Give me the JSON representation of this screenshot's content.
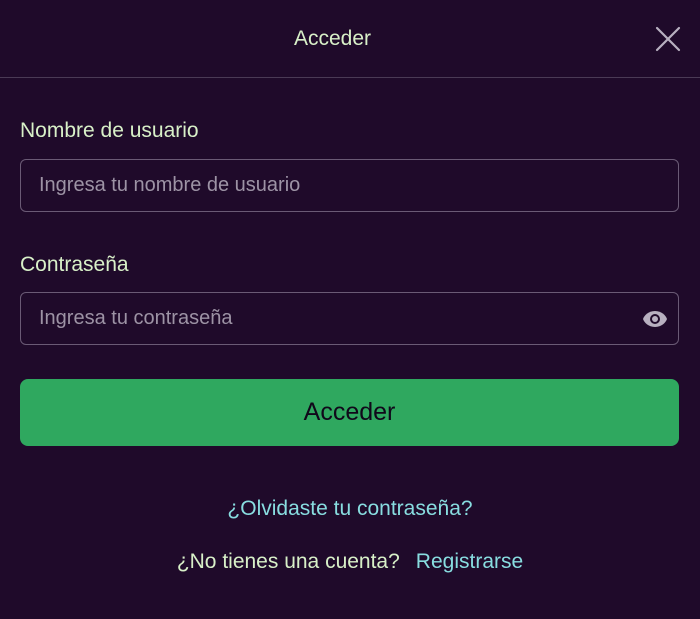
{
  "dialog": {
    "title": "Acceder"
  },
  "username": {
    "label": "Nombre de usuario",
    "placeholder": "Ingresa tu nombre de usuario",
    "value": ""
  },
  "password": {
    "label": "Contraseña",
    "placeholder": "Ingresa tu contraseña",
    "value": ""
  },
  "submit": {
    "label": "Acceder"
  },
  "links": {
    "forgot_password": "¿Olvidaste tu contraseña?",
    "no_account_text": "¿No tienes una cuenta?",
    "register": "Registrarse"
  },
  "colors": {
    "background": "#1f0a2a",
    "primary_button": "#2fa85f",
    "link": "#88dde0",
    "label_text": "#d8f0c8"
  },
  "icons": {
    "close": "close-icon",
    "toggle_password_visibility": "eye-icon"
  }
}
